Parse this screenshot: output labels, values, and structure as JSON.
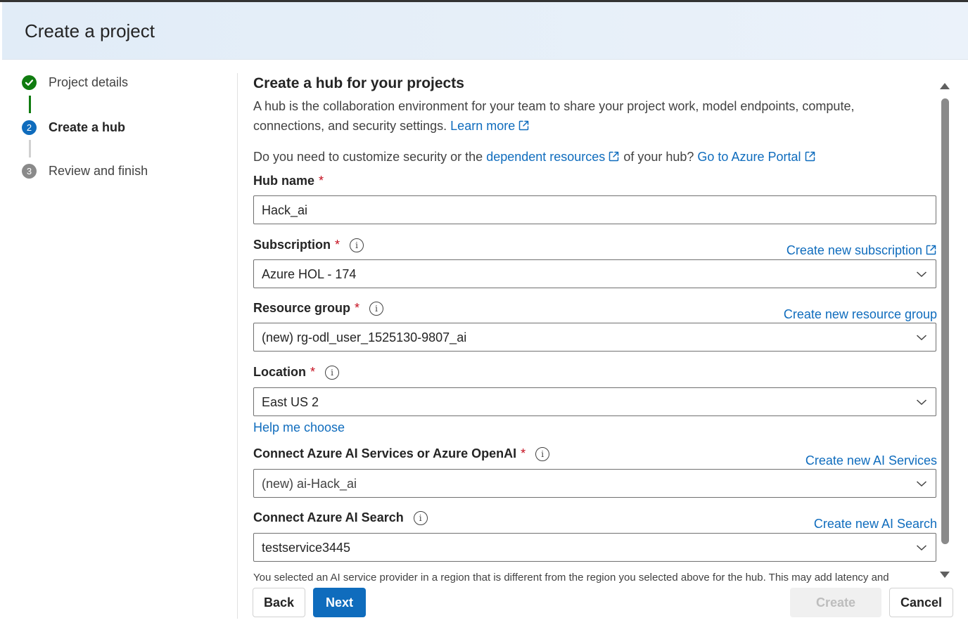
{
  "dialog": {
    "title": "Create a project"
  },
  "steps": [
    {
      "num": "1",
      "label": "Project details",
      "state": "done"
    },
    {
      "num": "2",
      "label": "Create a hub",
      "state": "active"
    },
    {
      "num": "3",
      "label": "Review and finish",
      "state": "pending"
    }
  ],
  "main": {
    "title": "Create a hub for your projects",
    "desc_text": "A hub is the collaboration environment for your team to share your project work, model endpoints, compute, connections, and security settings.",
    "learn_more": "Learn more",
    "q_prefix": "Do you need to customize security or the",
    "q_link1": "dependent resources",
    "q_middle": "of your hub?",
    "q_link2": "Go to Azure Portal"
  },
  "fields": {
    "hub_name": {
      "label": "Hub name",
      "required": "*",
      "value": "Hack_ai"
    },
    "subscription": {
      "label": "Subscription",
      "required": "*",
      "value": "Azure HOL - 174",
      "link": "Create new subscription"
    },
    "resource_group": {
      "label": "Resource group",
      "required": "*",
      "value": "(new) rg-odl_user_1525130-9807_ai",
      "link": "Create new resource group"
    },
    "location": {
      "label": "Location",
      "required": "*",
      "value": "East US 2",
      "help": "Help me choose"
    },
    "ai_services": {
      "label": "Connect Azure AI Services or Azure OpenAI",
      "required": "*",
      "value": "(new) ai-Hack_ai",
      "link": "Create new AI Services"
    },
    "ai_search": {
      "label": "Connect Azure AI Search",
      "value": "testservice3445",
      "link": "Create new AI Search"
    }
  },
  "note": "You selected an AI service provider in a region that is different from the region you selected above for the hub. This may add latency and",
  "buttons": {
    "back": "Back",
    "next": "Next",
    "create": "Create",
    "cancel": "Cancel"
  },
  "icons": {
    "info": "info-icon",
    "external": "external-link-icon",
    "chevron": "chevron-down-icon",
    "check": "checkmark-icon"
  },
  "colors": {
    "accent": "#0f6cbd",
    "success": "#107c10",
    "required": "#c50f1f"
  }
}
